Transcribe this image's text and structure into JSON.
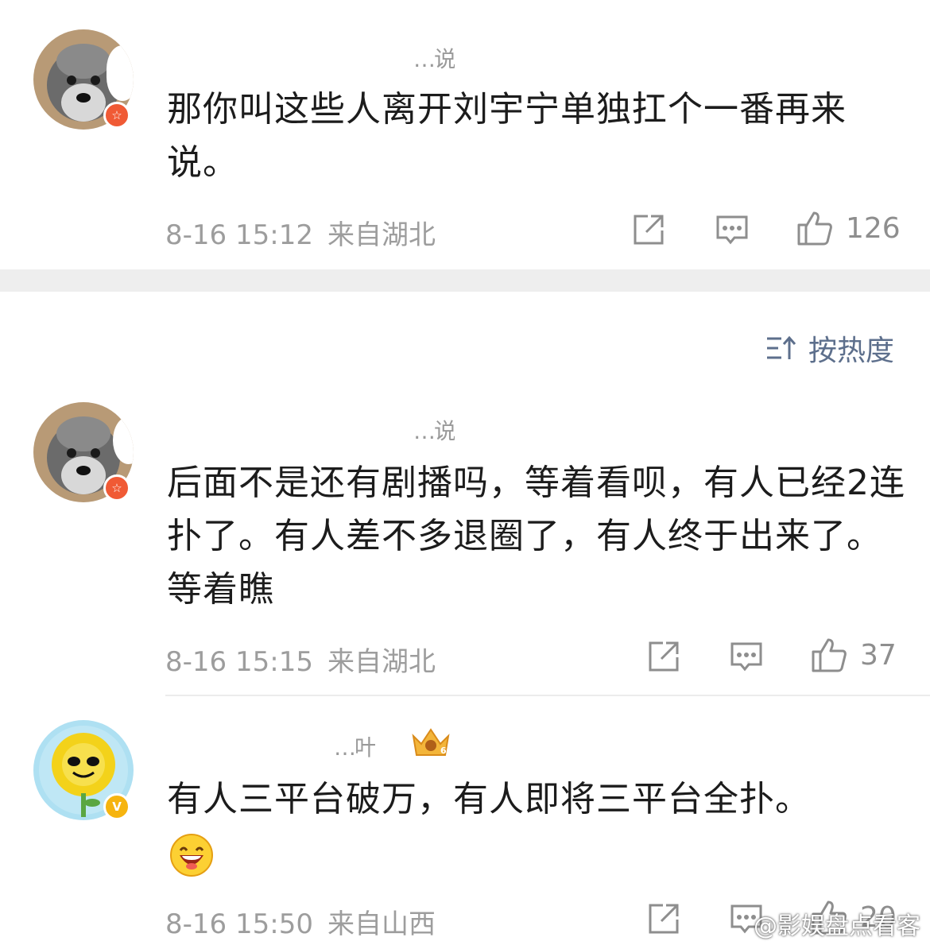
{
  "comments": [
    {
      "username": "…说",
      "text": "那你叫这些人离开刘宇宁单独扛个一番再来说。",
      "time": "8-16 15:12",
      "location": "来自湖北",
      "likes": "126"
    },
    {
      "username": "…说",
      "text": "后面不是还有剧播吗，等着看呗，有人已经2连扑了。有人差不多退圈了，有人终于出来了。等着瞧",
      "time": "8-16 15:15",
      "location": "来自湖北",
      "likes": "37"
    },
    {
      "username": "…叶",
      "text": "有人三平台破万，有人即将三平台全扑。",
      "time": "8-16 15:50",
      "location": "来自山西",
      "likes": "20"
    }
  ],
  "sort": {
    "label": "按热度"
  },
  "watermark": "@影娱盘点看客",
  "icons": {
    "share": "share-icon",
    "reply": "comment-icon",
    "like": "thumbs-up-icon",
    "sort": "sort-icon",
    "badge_red": "star-badge-icon",
    "badge_gold": "verified-v-icon",
    "crown": "crown-level-icon",
    "emoji": "laughing-emoji-icon"
  },
  "colors": {
    "badge_red": "#f05a35",
    "badge_gold": "#f6b40f",
    "sort_text": "#5d6f8c",
    "meta_text": "#9d9d9d"
  }
}
